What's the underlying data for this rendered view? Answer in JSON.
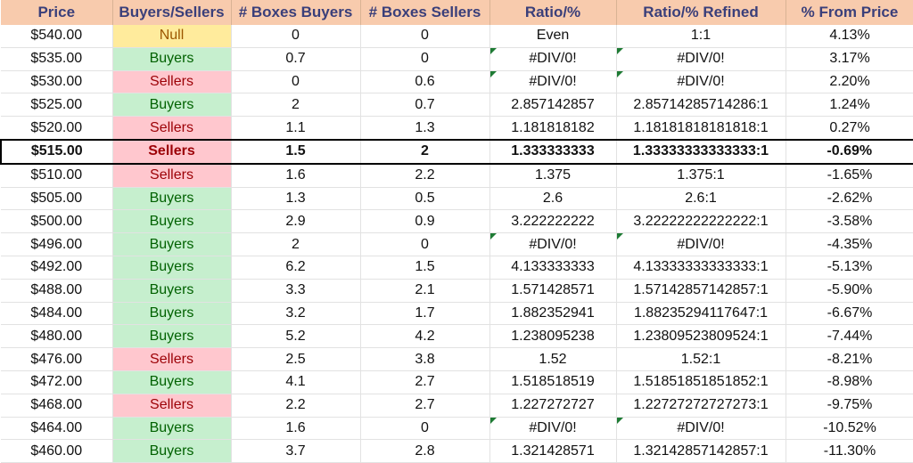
{
  "headers": [
    "Price",
    "Buyers/Sellers",
    "# Boxes Buyers",
    "# Boxes Sellers",
    "Ratio/%",
    "Ratio/% Refined",
    "% From Price"
  ],
  "current_price_row": "$515.00",
  "status_colors": {
    "Buyers": "#C6EFCE",
    "Sellers": "#FFC7CE",
    "Null": "#FFEB9C",
    "header": "#F8CBAD"
  },
  "rows": [
    [
      "$540.00",
      "Null",
      "0",
      "0",
      "Even",
      "1:1",
      "4.13%"
    ],
    [
      "$535.00",
      "Buyers",
      "0.7",
      "0",
      "#DIV/0!",
      "#DIV/0!",
      "3.17%"
    ],
    [
      "$530.00",
      "Sellers",
      "0",
      "0.6",
      "#DIV/0!",
      "#DIV/0!",
      "2.20%"
    ],
    [
      "$525.00",
      "Buyers",
      "2",
      "0.7",
      "2.857142857",
      "2.85714285714286:1",
      "1.24%"
    ],
    [
      "$520.00",
      "Sellers",
      "1.1",
      "1.3",
      "1.181818182",
      "1.18181818181818:1",
      "0.27%"
    ],
    [
      "$515.00",
      "Sellers",
      "1.5",
      "2",
      "1.333333333",
      "1.33333333333333:1",
      "-0.69%"
    ],
    [
      "$510.00",
      "Sellers",
      "1.6",
      "2.2",
      "1.375",
      "1.375:1",
      "-1.65%"
    ],
    [
      "$505.00",
      "Buyers",
      "1.3",
      "0.5",
      "2.6",
      "2.6:1",
      "-2.62%"
    ],
    [
      "$500.00",
      "Buyers",
      "2.9",
      "0.9",
      "3.222222222",
      "3.22222222222222:1",
      "-3.58%"
    ],
    [
      "$496.00",
      "Buyers",
      "2",
      "0",
      "#DIV/0!",
      "#DIV/0!",
      "-4.35%"
    ],
    [
      "$492.00",
      "Buyers",
      "6.2",
      "1.5",
      "4.133333333",
      "4.13333333333333:1",
      "-5.13%"
    ],
    [
      "$488.00",
      "Buyers",
      "3.3",
      "2.1",
      "1.571428571",
      "1.57142857142857:1",
      "-5.90%"
    ],
    [
      "$484.00",
      "Buyers",
      "3.2",
      "1.7",
      "1.882352941",
      "1.88235294117647:1",
      "-6.67%"
    ],
    [
      "$480.00",
      "Buyers",
      "5.2",
      "4.2",
      "1.238095238",
      "1.23809523809524:1",
      "-7.44%"
    ],
    [
      "$476.00",
      "Sellers",
      "2.5",
      "3.8",
      "1.52",
      "1.52:1",
      "-8.21%"
    ],
    [
      "$472.00",
      "Buyers",
      "4.1",
      "2.7",
      "1.518518519",
      "1.51851851851852:1",
      "-8.98%"
    ],
    [
      "$468.00",
      "Sellers",
      "2.2",
      "2.7",
      "1.227272727",
      "1.22727272727273:1",
      "-9.75%"
    ],
    [
      "$464.00",
      "Buyers",
      "1.6",
      "0",
      "#DIV/0!",
      "#DIV/0!",
      "-10.52%"
    ],
    [
      "$460.00",
      "Buyers",
      "3.7",
      "2.8",
      "1.321428571",
      "1.32142857142857:1",
      "-11.30%"
    ]
  ]
}
